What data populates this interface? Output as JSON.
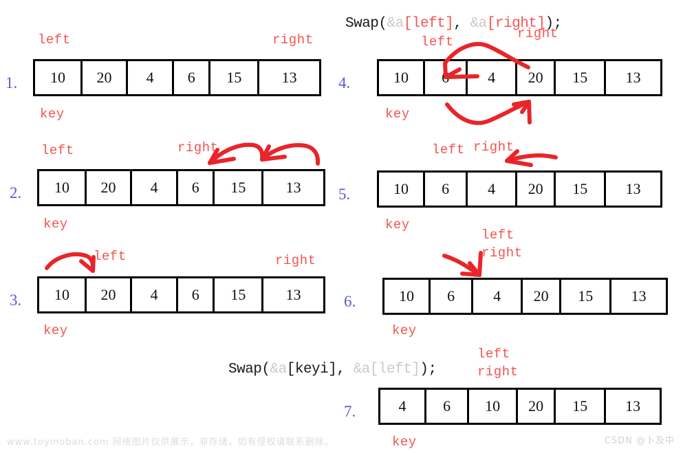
{
  "diagram": {
    "title_hidden": "",
    "code_lines": [
      {
        "id": "swap-left-right",
        "segments": [
          {
            "text": "Swap(",
            "color": "black"
          },
          {
            "text": "&a",
            "color": "gray"
          },
          {
            "text": "[left]",
            "color": "red"
          },
          {
            "text": ", ",
            "color": "black"
          },
          {
            "text": "&a",
            "color": "gray"
          },
          {
            "text": "[right]",
            "color": "red"
          },
          {
            "text": ");",
            "color": "black"
          }
        ],
        "plain": "Swap(&a[left], &a[right]);"
      },
      {
        "id": "swap-keyi-left",
        "segments": [
          {
            "text": "Swap(",
            "color": "black"
          },
          {
            "text": "&a",
            "color": "gray"
          },
          {
            "text": "[keyi]",
            "color": "black"
          },
          {
            "text": ", ",
            "color": "black"
          },
          {
            "text": "&a",
            "color": "gray"
          },
          {
            "text": "[left]",
            "color": "gray"
          },
          {
            "text": ");",
            "color": "black"
          }
        ],
        "plain": "Swap(&a[keyi], &a[left]);"
      }
    ],
    "steps": [
      {
        "number": "1.",
        "values": [
          "10",
          "20",
          "4",
          "6",
          "15",
          "13"
        ],
        "labels_above": [
          "left",
          "right"
        ],
        "labels_below": [
          "key"
        ]
      },
      {
        "number": "2.",
        "values": [
          "10",
          "20",
          "4",
          "6",
          "15",
          "13"
        ],
        "labels_above": [
          "left",
          "right"
        ],
        "labels_below": [
          "key"
        ]
      },
      {
        "number": "3.",
        "values": [
          "10",
          "20",
          "4",
          "6",
          "15",
          "13"
        ],
        "labels_above": [
          "left",
          "right"
        ],
        "labels_below": [
          "key"
        ]
      },
      {
        "number": "4.",
        "values": [
          "10",
          "6",
          "4",
          "20",
          "15",
          "13"
        ],
        "labels_above": [
          "left",
          "right"
        ],
        "labels_below": [
          "key"
        ]
      },
      {
        "number": "5.",
        "values": [
          "10",
          "6",
          "4",
          "20",
          "15",
          "13"
        ],
        "labels_above": [
          "left",
          "right"
        ],
        "labels_below": [
          "key"
        ]
      },
      {
        "number": "6.",
        "values": [
          "10",
          "6",
          "4",
          "20",
          "15",
          "13"
        ],
        "labels_above": [
          "left",
          "right"
        ],
        "labels_below": [
          "key"
        ]
      },
      {
        "number": "7.",
        "values": [
          "4",
          "6",
          "10",
          "20",
          "15",
          "13"
        ],
        "labels_above": [
          "left",
          "right"
        ],
        "labels_below": [
          "key"
        ]
      }
    ],
    "label_text": {
      "left": "left",
      "right": "right",
      "key": "key"
    },
    "colors": {
      "annotation_red": "#f4544f",
      "arrow_red": "#e8252a",
      "step_number_blue": "#5a5ad6",
      "cell_border": "#000000",
      "code_gray": "#c9c9c9"
    }
  },
  "watermarks": {
    "left": "www.toymoban.com 网络图片仅供展示，非存储，如有侵权请联系删除。",
    "right": "CSDN @卜及中"
  }
}
